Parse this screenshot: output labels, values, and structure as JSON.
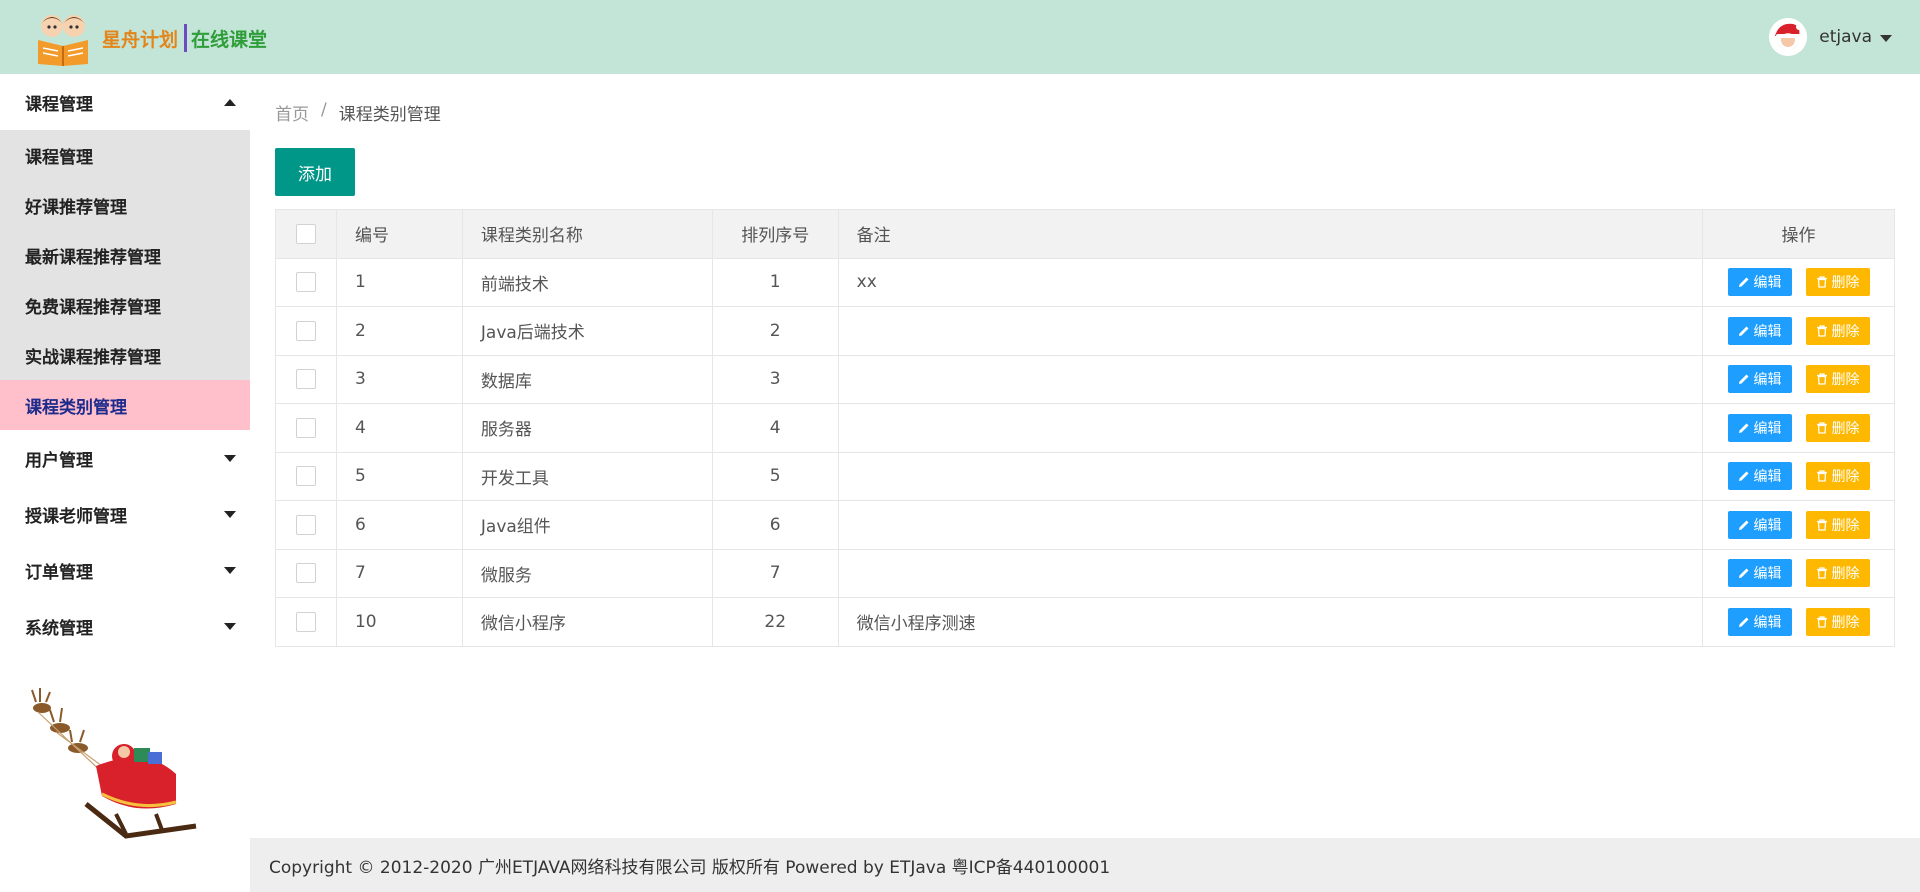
{
  "header": {
    "logo_text_a": "星舟计划",
    "logo_text_b": "在线课堂",
    "username": "etjava"
  },
  "sidebar": {
    "groups": [
      {
        "label": "课程管理",
        "expanded": true,
        "items": [
          {
            "label": "课程管理"
          },
          {
            "label": "好课推荐管理"
          },
          {
            "label": "最新课程推荐管理"
          },
          {
            "label": "免费课程推荐管理"
          },
          {
            "label": "实战课程推荐管理"
          },
          {
            "label": "课程类别管理",
            "active": true
          }
        ]
      },
      {
        "label": "用户管理"
      },
      {
        "label": "授课老师管理"
      },
      {
        "label": "订单管理"
      },
      {
        "label": "系统管理"
      }
    ]
  },
  "breadcrumb": {
    "home": "首页",
    "separator": "/",
    "current": "课程类别管理"
  },
  "toolbar": {
    "add_label": "添加"
  },
  "table": {
    "headers": {
      "id": "编号",
      "name": "课程类别名称",
      "order": "排列序号",
      "remark": "备注",
      "ops": "操作"
    },
    "edit_label": "编辑",
    "delete_label": "删除",
    "rows": [
      {
        "id": "1",
        "name": "前端技术",
        "order": "1",
        "remark": "xx"
      },
      {
        "id": "2",
        "name": "Java后端技术",
        "order": "2",
        "remark": ""
      },
      {
        "id": "3",
        "name": "数据库",
        "order": "3",
        "remark": ""
      },
      {
        "id": "4",
        "name": "服务器",
        "order": "4",
        "remark": ""
      },
      {
        "id": "5",
        "name": "开发工具",
        "order": "5",
        "remark": ""
      },
      {
        "id": "6",
        "name": "Java组件",
        "order": "6",
        "remark": ""
      },
      {
        "id": "7",
        "name": "微服务",
        "order": "7",
        "remark": ""
      },
      {
        "id": "10",
        "name": "微信小程序",
        "order": "22",
        "remark": "微信小程序测速"
      }
    ]
  },
  "footer": {
    "text": "Copyright © 2012-2020 广州ETJAVA网络科技有限公司 版权所有 Powered by ETJava 粤ICP备440100001"
  },
  "colors": {
    "header_bg": "#c3e5d7",
    "primary": "#009688",
    "edit": "#1e9fff",
    "delete": "#ffb800",
    "active_nav": "#ffc0cb"
  }
}
